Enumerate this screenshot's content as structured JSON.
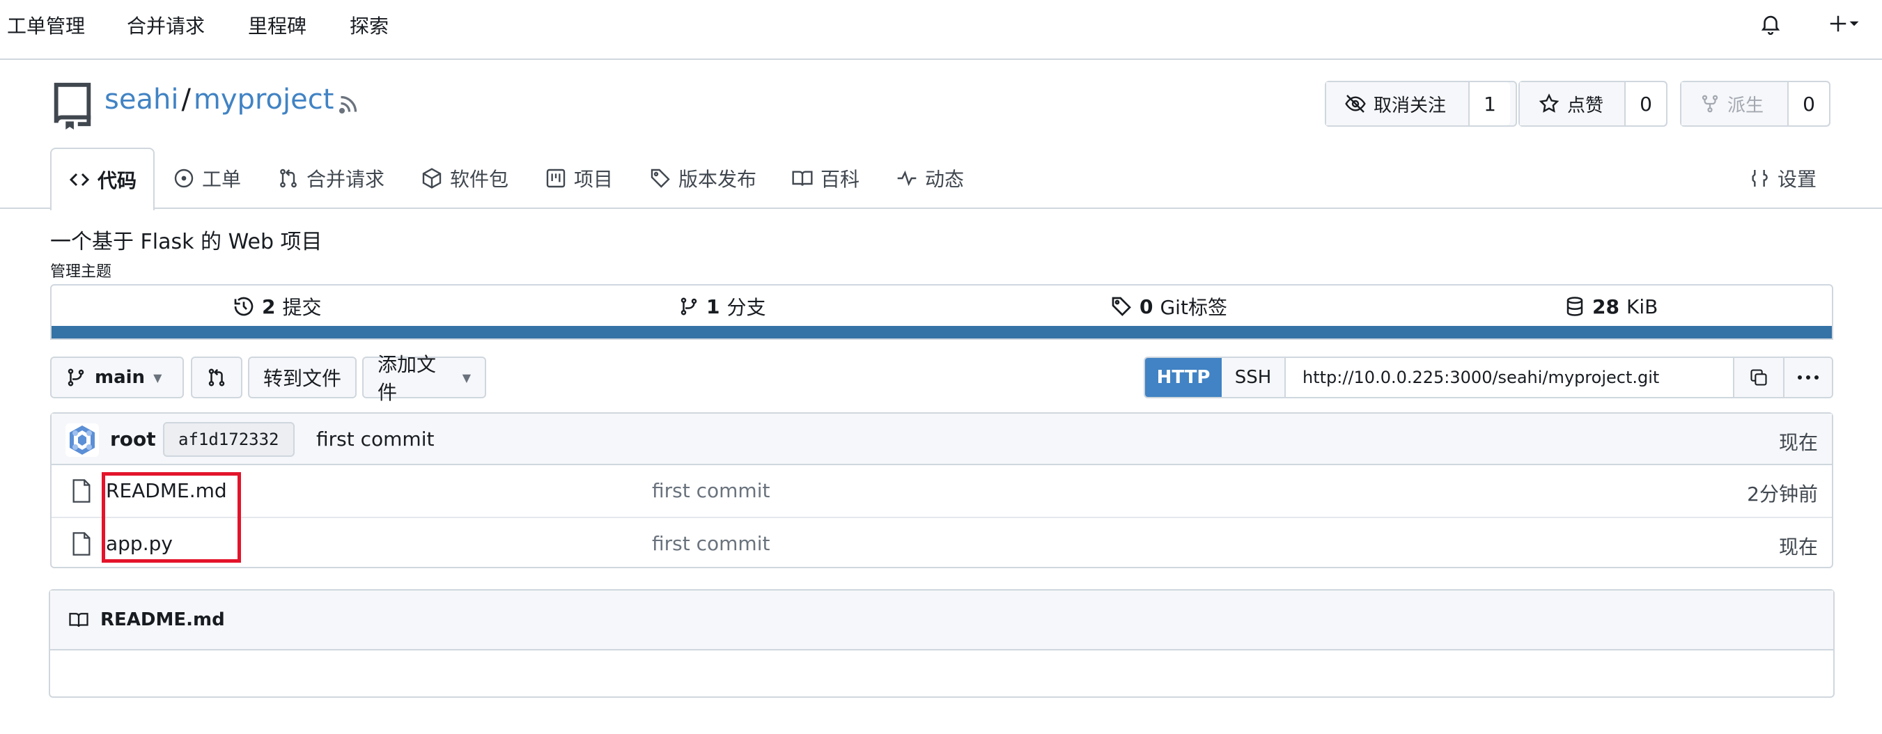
{
  "topnav": {
    "links": [
      "工单管理",
      "合并请求",
      "里程碑",
      "探索"
    ]
  },
  "repo": {
    "owner": "seahi",
    "name": "myproject",
    "watch": {
      "label": "取消关注",
      "count": "1"
    },
    "star": {
      "label": "点赞",
      "count": "0"
    },
    "fork": {
      "label": "派生",
      "count": "0"
    }
  },
  "tabs": {
    "code": "代码",
    "issues": "工单",
    "pulls": "合并请求",
    "packages": "软件包",
    "projects": "项目",
    "releases": "版本发布",
    "wiki": "百科",
    "activity": "动态",
    "settings": "设置"
  },
  "description": "一个基于 Flask 的 Web 项目",
  "manage_topics": "管理主题",
  "stats": {
    "commits_count": "2",
    "commits_label": "提交",
    "branches_count": "1",
    "branches_label": "分支",
    "tags_count": "0",
    "tags_label": "Git标签",
    "size_value": "28",
    "size_unit": "KiB"
  },
  "toolbar": {
    "branch": "main",
    "goto_file": "转到文件",
    "add_file": "添加文件",
    "http": "HTTP",
    "ssh": "SSH",
    "clone_url": "http://10.0.0.225:3000/seahi/myproject.git"
  },
  "latest_commit": {
    "author": "root",
    "sha": "af1d172332",
    "message": "first commit",
    "time": "现在"
  },
  "files": [
    {
      "name": "README.md",
      "commit": "first commit",
      "time": "2分钟前"
    },
    {
      "name": "app.py",
      "commit": "first commit",
      "time": "现在"
    }
  ],
  "readme": {
    "title": "README.md"
  },
  "colors": {
    "accent": "#4183c4",
    "language_bar": "#3572a5",
    "highlight": "#e3142b"
  }
}
